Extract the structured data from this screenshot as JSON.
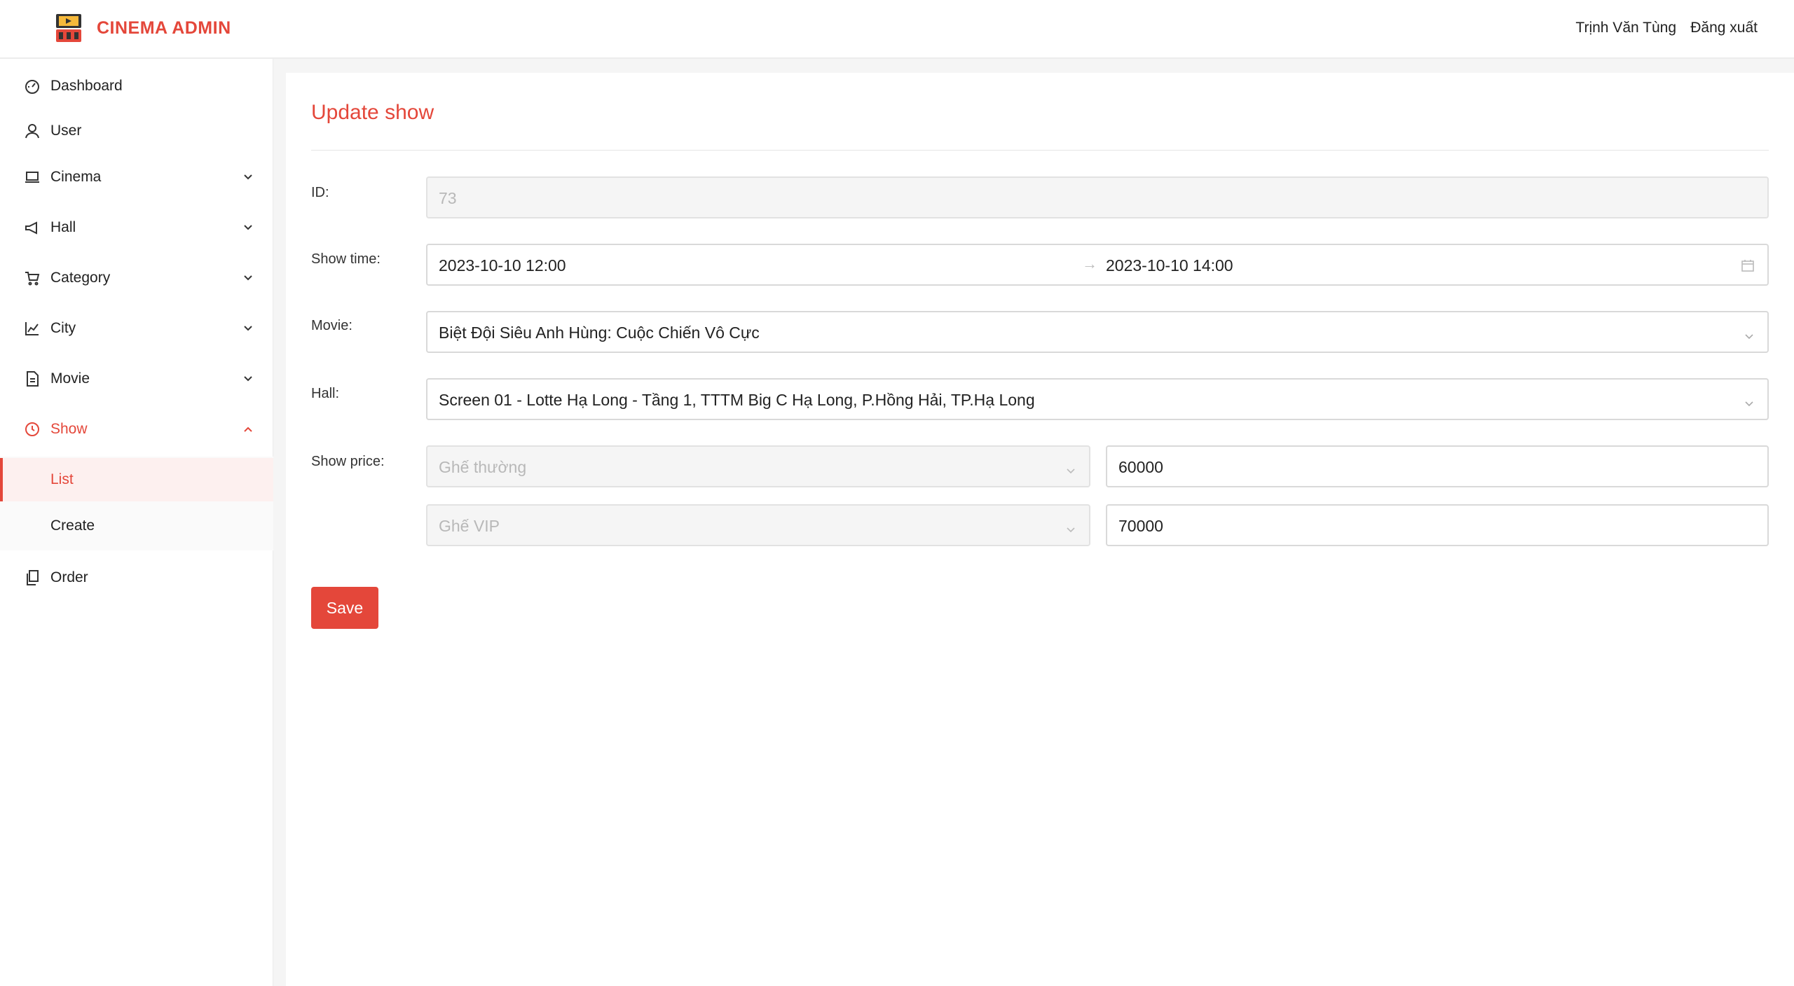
{
  "header": {
    "brand": "CINEMA ADMIN",
    "user_name": "Trịnh Văn Tùng",
    "logout_label": "Đăng xuất",
    "accent_color": "#e4473a"
  },
  "sidebar": {
    "items": [
      {
        "label": "Dashboard",
        "icon": "dashboard-icon"
      },
      {
        "label": "User",
        "icon": "user-icon"
      },
      {
        "label": "Cinema",
        "icon": "laptop-icon"
      },
      {
        "label": "Hall",
        "icon": "megaphone-icon"
      },
      {
        "label": "Category",
        "icon": "cart-icon"
      },
      {
        "label": "City",
        "icon": "chart-icon"
      },
      {
        "label": "Movie",
        "icon": "file-icon"
      },
      {
        "label": "Show",
        "icon": "clock-icon"
      },
      {
        "label": "Order",
        "icon": "copy-icon"
      }
    ],
    "show_submenu": [
      {
        "label": "List"
      },
      {
        "label": "Create"
      }
    ],
    "active_item": "Show",
    "selected_subitem": "List"
  },
  "form": {
    "title": "Update show",
    "id_label": "ID",
    "id_value": "73",
    "show_time_label": "Show time",
    "show_time_start": "2023-10-10 12:00",
    "show_time_end": "2023-10-10 14:00",
    "movie_label": "Movie",
    "movie_value": "Biệt Đội Siêu Anh Hùng: Cuộc Chiến Vô Cực",
    "hall_label": "Hall",
    "hall_value": "Screen 01 - Lotte Hạ Long - Tầng 1, TTTM Big C Hạ Long, P.Hồng Hải, TP.Hạ Long",
    "show_price_label": "Show price",
    "prices": [
      {
        "seat_type": "Ghế thường",
        "price": "60000"
      },
      {
        "seat_type": "Ghế VIP",
        "price": "70000"
      }
    ],
    "save_label": "Save"
  }
}
